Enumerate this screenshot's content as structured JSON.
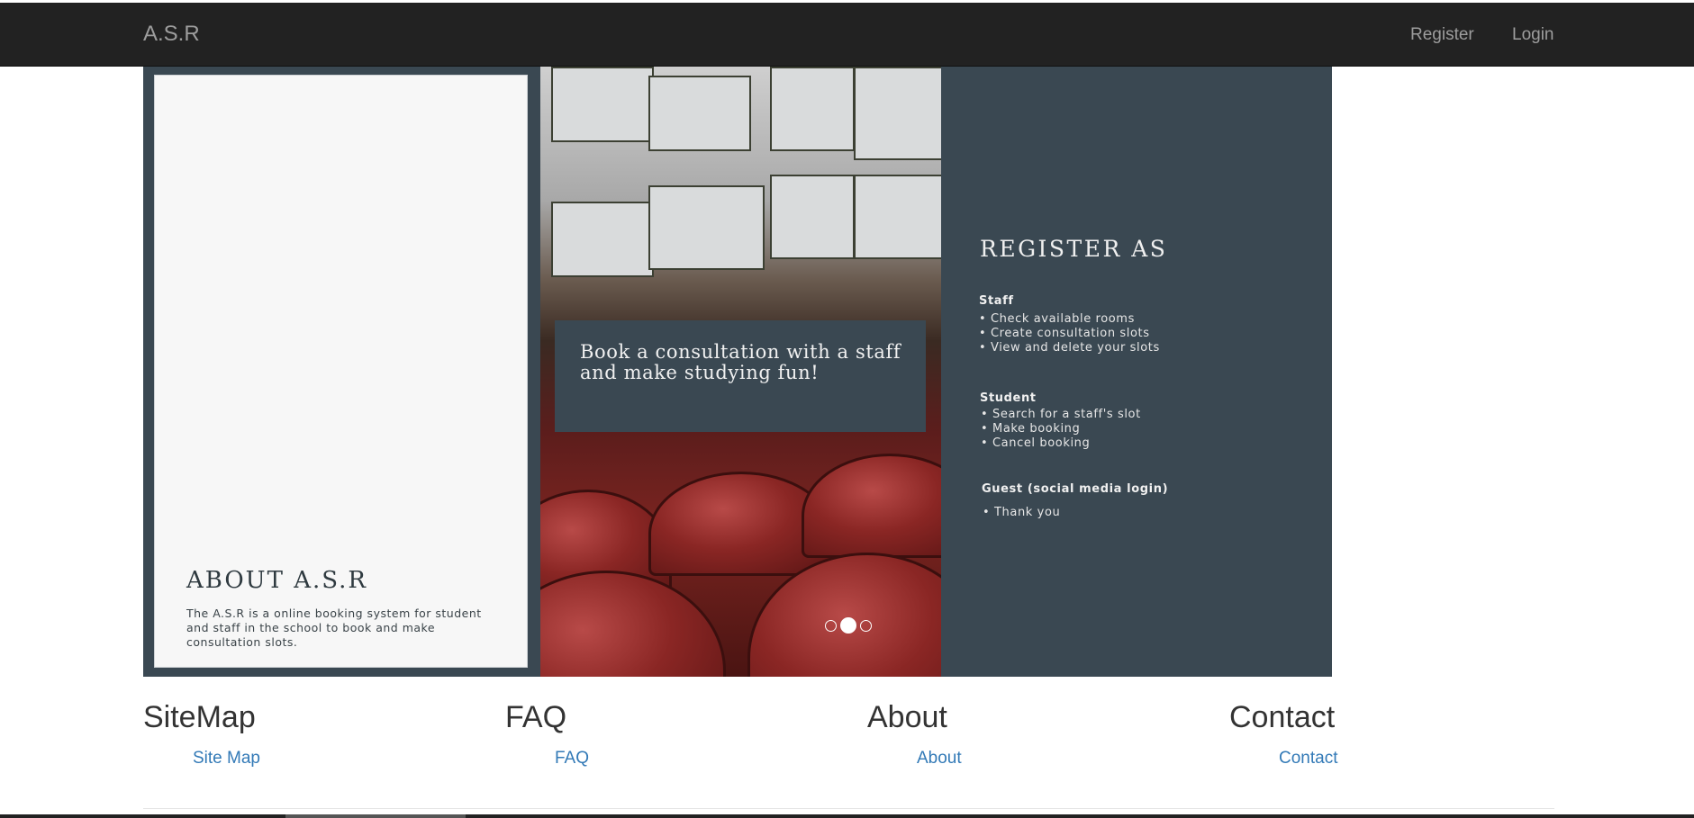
{
  "navbar": {
    "brand": "A.S.R",
    "links": [
      {
        "label": "Register"
      },
      {
        "label": "Login"
      }
    ]
  },
  "carousel": {
    "active_index": 1,
    "slide_count": 3,
    "about": {
      "title": "ABOUT A.S.R",
      "text": "The A.S.R is a online booking system for student and staff in the school to book and make consultation slots."
    },
    "middle": {
      "text": "Book a consultation with a staff and make studying fun!"
    },
    "register": {
      "title": "REGISTER AS",
      "groups": [
        {
          "title": "Staff",
          "items": [
            "• Check available rooms",
            "• Create consultation slots",
            "• View and delete your slots"
          ]
        },
        {
          "title": "Student",
          "items": [
            "• Search for a staff's slot",
            "• Make booking",
            "• Cancel booking"
          ]
        },
        {
          "title": "Guest (social media login)",
          "items": [
            "• Thank you"
          ]
        }
      ]
    }
  },
  "footer": {
    "columns": [
      {
        "heading": "SiteMap",
        "link": "Site Map"
      },
      {
        "heading": "FAQ",
        "link": "FAQ"
      },
      {
        "heading": "About",
        "link": "About"
      },
      {
        "heading": "Contact",
        "link": "Contact"
      }
    ]
  },
  "colors": {
    "navbar_bg": "#222222",
    "slate_panel": "#3a4852",
    "link": "#337ab7"
  }
}
